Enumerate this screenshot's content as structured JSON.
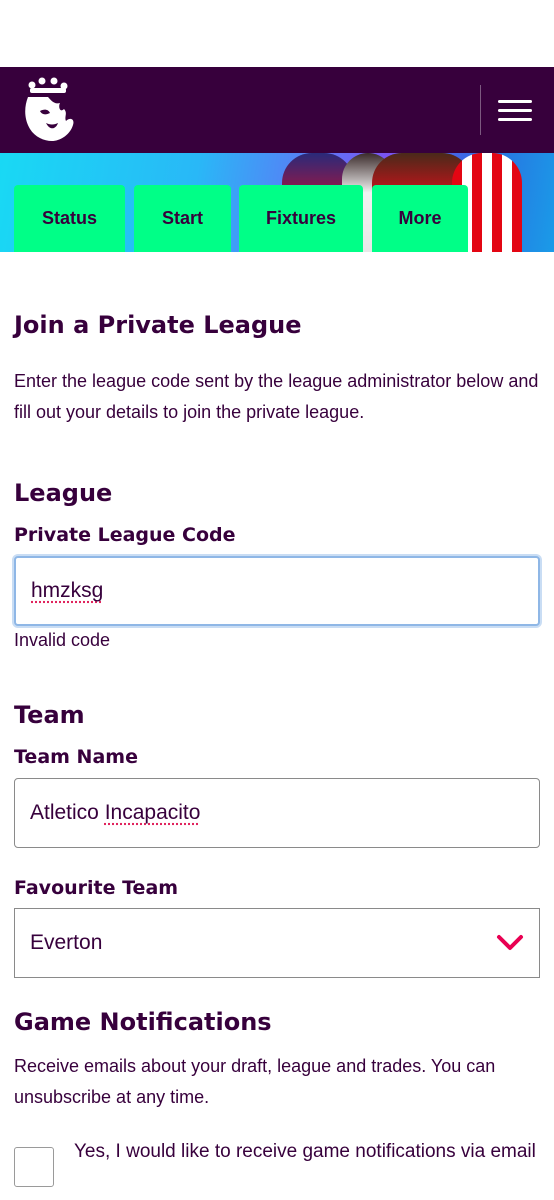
{
  "header": {
    "logo_icon": "premier-league-lion-icon",
    "menu_icon": "hamburger-menu-icon",
    "background_color": "#37003c"
  },
  "tabs": [
    {
      "label": "Status"
    },
    {
      "label": "Start"
    },
    {
      "label": "Fixtures"
    },
    {
      "label": "More"
    }
  ],
  "form": {
    "title": "Join a Private League",
    "intro": "Enter the league code sent by the league administrator below and fill out your details to join the private league.",
    "league_section": {
      "heading": "League",
      "code_label": "Private League Code",
      "code_value": "hmzksg",
      "code_error": "Invalid code"
    },
    "team_section": {
      "heading": "Team",
      "name_label": "Team Name",
      "name_value": "Atletico Incapacito",
      "fav_label": "Favourite Team",
      "fav_value": "Everton",
      "fav_icon": "chevron-down-icon"
    },
    "notifications": {
      "heading": "Game Notifications",
      "description": "Receive emails about your draft, league and trades. You can unsubscribe at any time.",
      "checkbox_label": "Yes, I would like to receive game notifications via email",
      "checked": false
    }
  },
  "colors": {
    "primary": "#37003c",
    "accent_green": "#00ff87",
    "chevron_pink": "#e90052"
  }
}
